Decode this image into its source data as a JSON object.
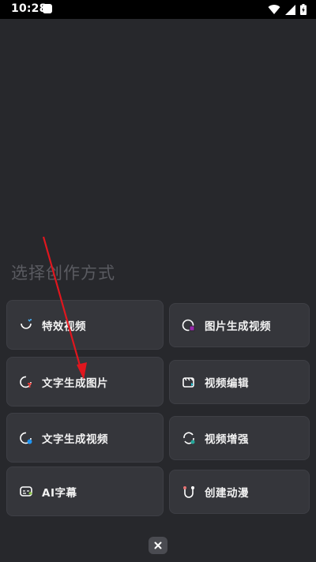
{
  "status_bar": {
    "time": "10:28",
    "icons": [
      "notification-square-icon",
      "wifi-icon",
      "signal-icon",
      "battery-icon"
    ]
  },
  "sheet": {
    "title": "选择创作方式",
    "options": [
      {
        "label": "特效视频",
        "icon": "effects-video-icon",
        "accent": "#4db6ff"
      },
      {
        "label": "图片生成视频",
        "icon": "image-to-video-icon",
        "accent": "#9c27b0"
      },
      {
        "label": "文字生成图片",
        "icon": "text-to-image-icon",
        "accent": "#e53935"
      },
      {
        "label": "视频编辑",
        "icon": "video-edit-icon",
        "accent": "#26c6da"
      },
      {
        "label": "文字生成视频",
        "icon": "text-to-video-icon",
        "accent": "#2196f3"
      },
      {
        "label": "视频增强",
        "icon": "video-enhance-icon",
        "accent": "#26a69a"
      },
      {
        "label": "AI字幕",
        "icon": "ai-subtitle-icon",
        "accent": "#8bc34a"
      },
      {
        "label": "创建动漫",
        "icon": "create-anime-icon",
        "accent": "#e57373"
      }
    ],
    "close_icon": "close-icon"
  },
  "annotation": {
    "color": "#e0161e"
  }
}
